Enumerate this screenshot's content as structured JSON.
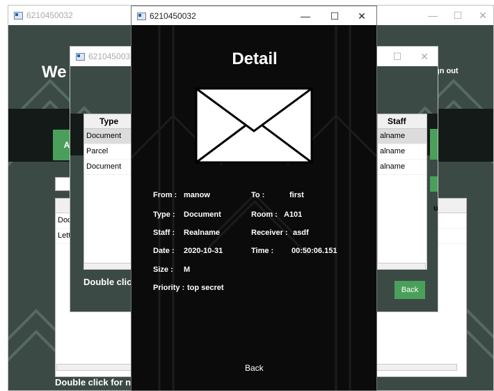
{
  "back_window": {
    "title": "6210450032",
    "welcome_text": "We",
    "sign_out": "gn out",
    "left_button": "A",
    "search_value": "",
    "rows": [
      "Doc",
      "Lett"
    ],
    "footer_text": "Double click for n"
  },
  "mid_window": {
    "title": "6210450032",
    "type_header": "Type",
    "type_rows": [
      "Document",
      "Parcel",
      "Document"
    ],
    "staff_header": "Staff",
    "staff_rows": [
      "alname",
      "alname",
      "alname"
    ],
    "footer_text": "Double clic",
    "back_button": "Back",
    "right_button": "rd",
    "refresh_button": "sh",
    "status_header": "us"
  },
  "detail_window": {
    "title": "6210450032",
    "heading": "Detail",
    "icon": "envelope-icon",
    "from_label": "From :",
    "from_value": "manow",
    "to_label": "To :",
    "to_value": "first",
    "type_label": "Type :",
    "type_value": "Document",
    "room_label": "Room :",
    "room_value": "A101",
    "staff_label": "Staff :",
    "staff_value": "Realname",
    "receiver_label": "Receiver :",
    "receiver_value": "asdf",
    "date_label": "Date :",
    "date_value": "2020-10-31",
    "time_label": "Time :",
    "time_value": "00:50:06.151",
    "size_label": "Size :",
    "size_value": "M",
    "priority_label": "Priority :",
    "priority_value": "top secret",
    "back_button": "Back"
  },
  "controls": {
    "minimize": "—",
    "maximize": "☐",
    "close": "✕"
  },
  "colors": {
    "green": "#4aa05a",
    "dark_bg": "#3c4a46",
    "detail_bg": "#0b0b0b"
  }
}
